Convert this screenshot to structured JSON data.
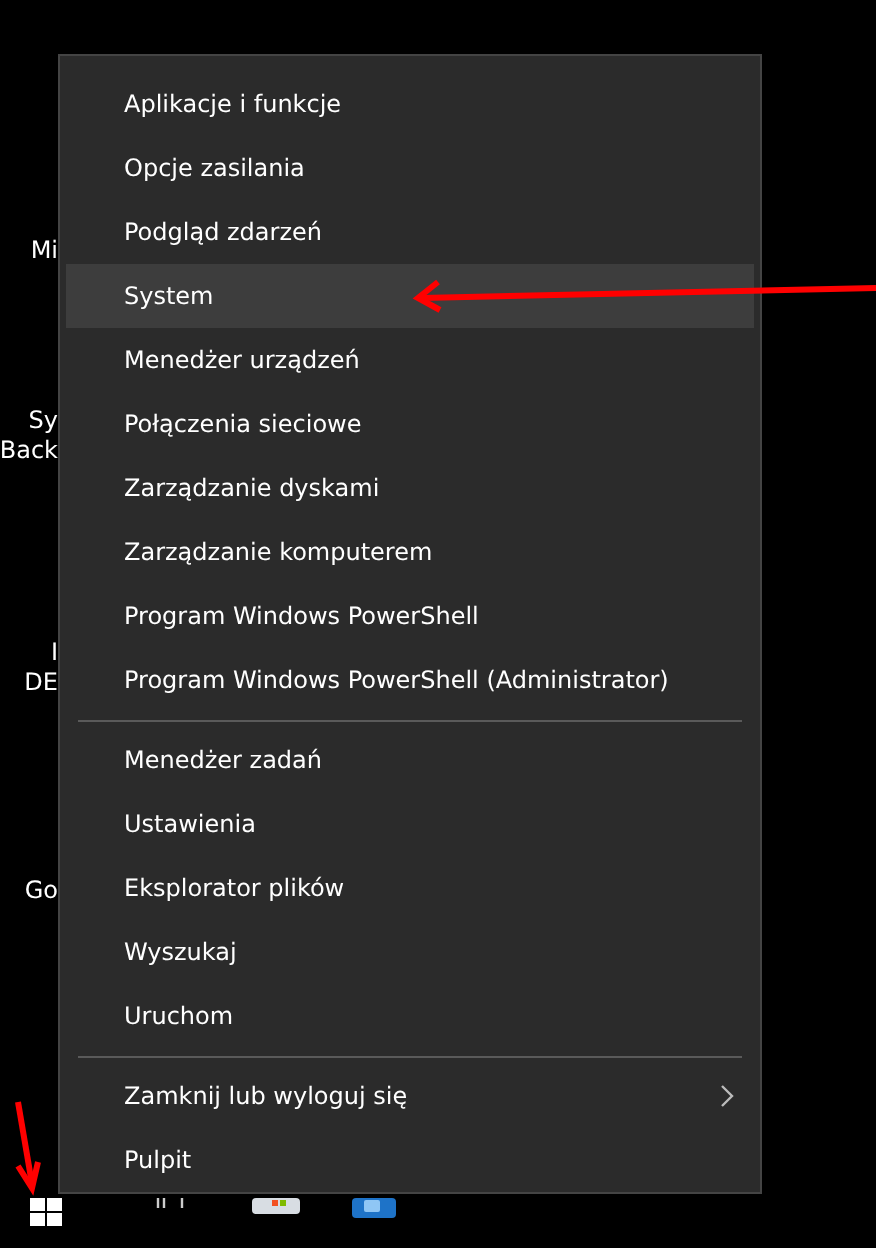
{
  "desktop_labels": [
    {
      "lines": [
        "Mi"
      ]
    },
    {
      "lines": [
        "Sy",
        "Back"
      ]
    },
    {
      "lines": [
        "I",
        "DE"
      ]
    },
    {
      "lines": [
        "Go"
      ]
    }
  ],
  "menu": {
    "groups": [
      {
        "items": [
          {
            "label": "Aplikacje i funkcje",
            "selected": false,
            "submenu": false
          },
          {
            "label": "Opcje zasilania",
            "selected": false,
            "submenu": false
          },
          {
            "label": "Podgląd zdarzeń",
            "selected": false,
            "submenu": false
          },
          {
            "label": "System",
            "selected": true,
            "submenu": false
          },
          {
            "label": "Menedżer urządzeń",
            "selected": false,
            "submenu": false
          },
          {
            "label": "Połączenia sieciowe",
            "selected": false,
            "submenu": false
          },
          {
            "label": "Zarządzanie dyskami",
            "selected": false,
            "submenu": false
          },
          {
            "label": "Zarządzanie komputerem",
            "selected": false,
            "submenu": false
          },
          {
            "label": "Program Windows PowerShell",
            "selected": false,
            "submenu": false
          },
          {
            "label": "Program Windows PowerShell (Administrator)",
            "selected": false,
            "submenu": false
          }
        ]
      },
      {
        "items": [
          {
            "label": "Menedżer zadań",
            "selected": false,
            "submenu": false
          },
          {
            "label": "Ustawienia",
            "selected": false,
            "submenu": false
          },
          {
            "label": "Eksplorator plików",
            "selected": false,
            "submenu": false
          },
          {
            "label": "Wyszukaj",
            "selected": false,
            "submenu": false
          },
          {
            "label": "Uruchom",
            "selected": false,
            "submenu": false
          }
        ]
      },
      {
        "items": [
          {
            "label": "Zamknij lub wyloguj się",
            "selected": false,
            "submenu": true
          },
          {
            "label": "Pulpit",
            "selected": false,
            "submenu": false
          }
        ]
      }
    ]
  }
}
